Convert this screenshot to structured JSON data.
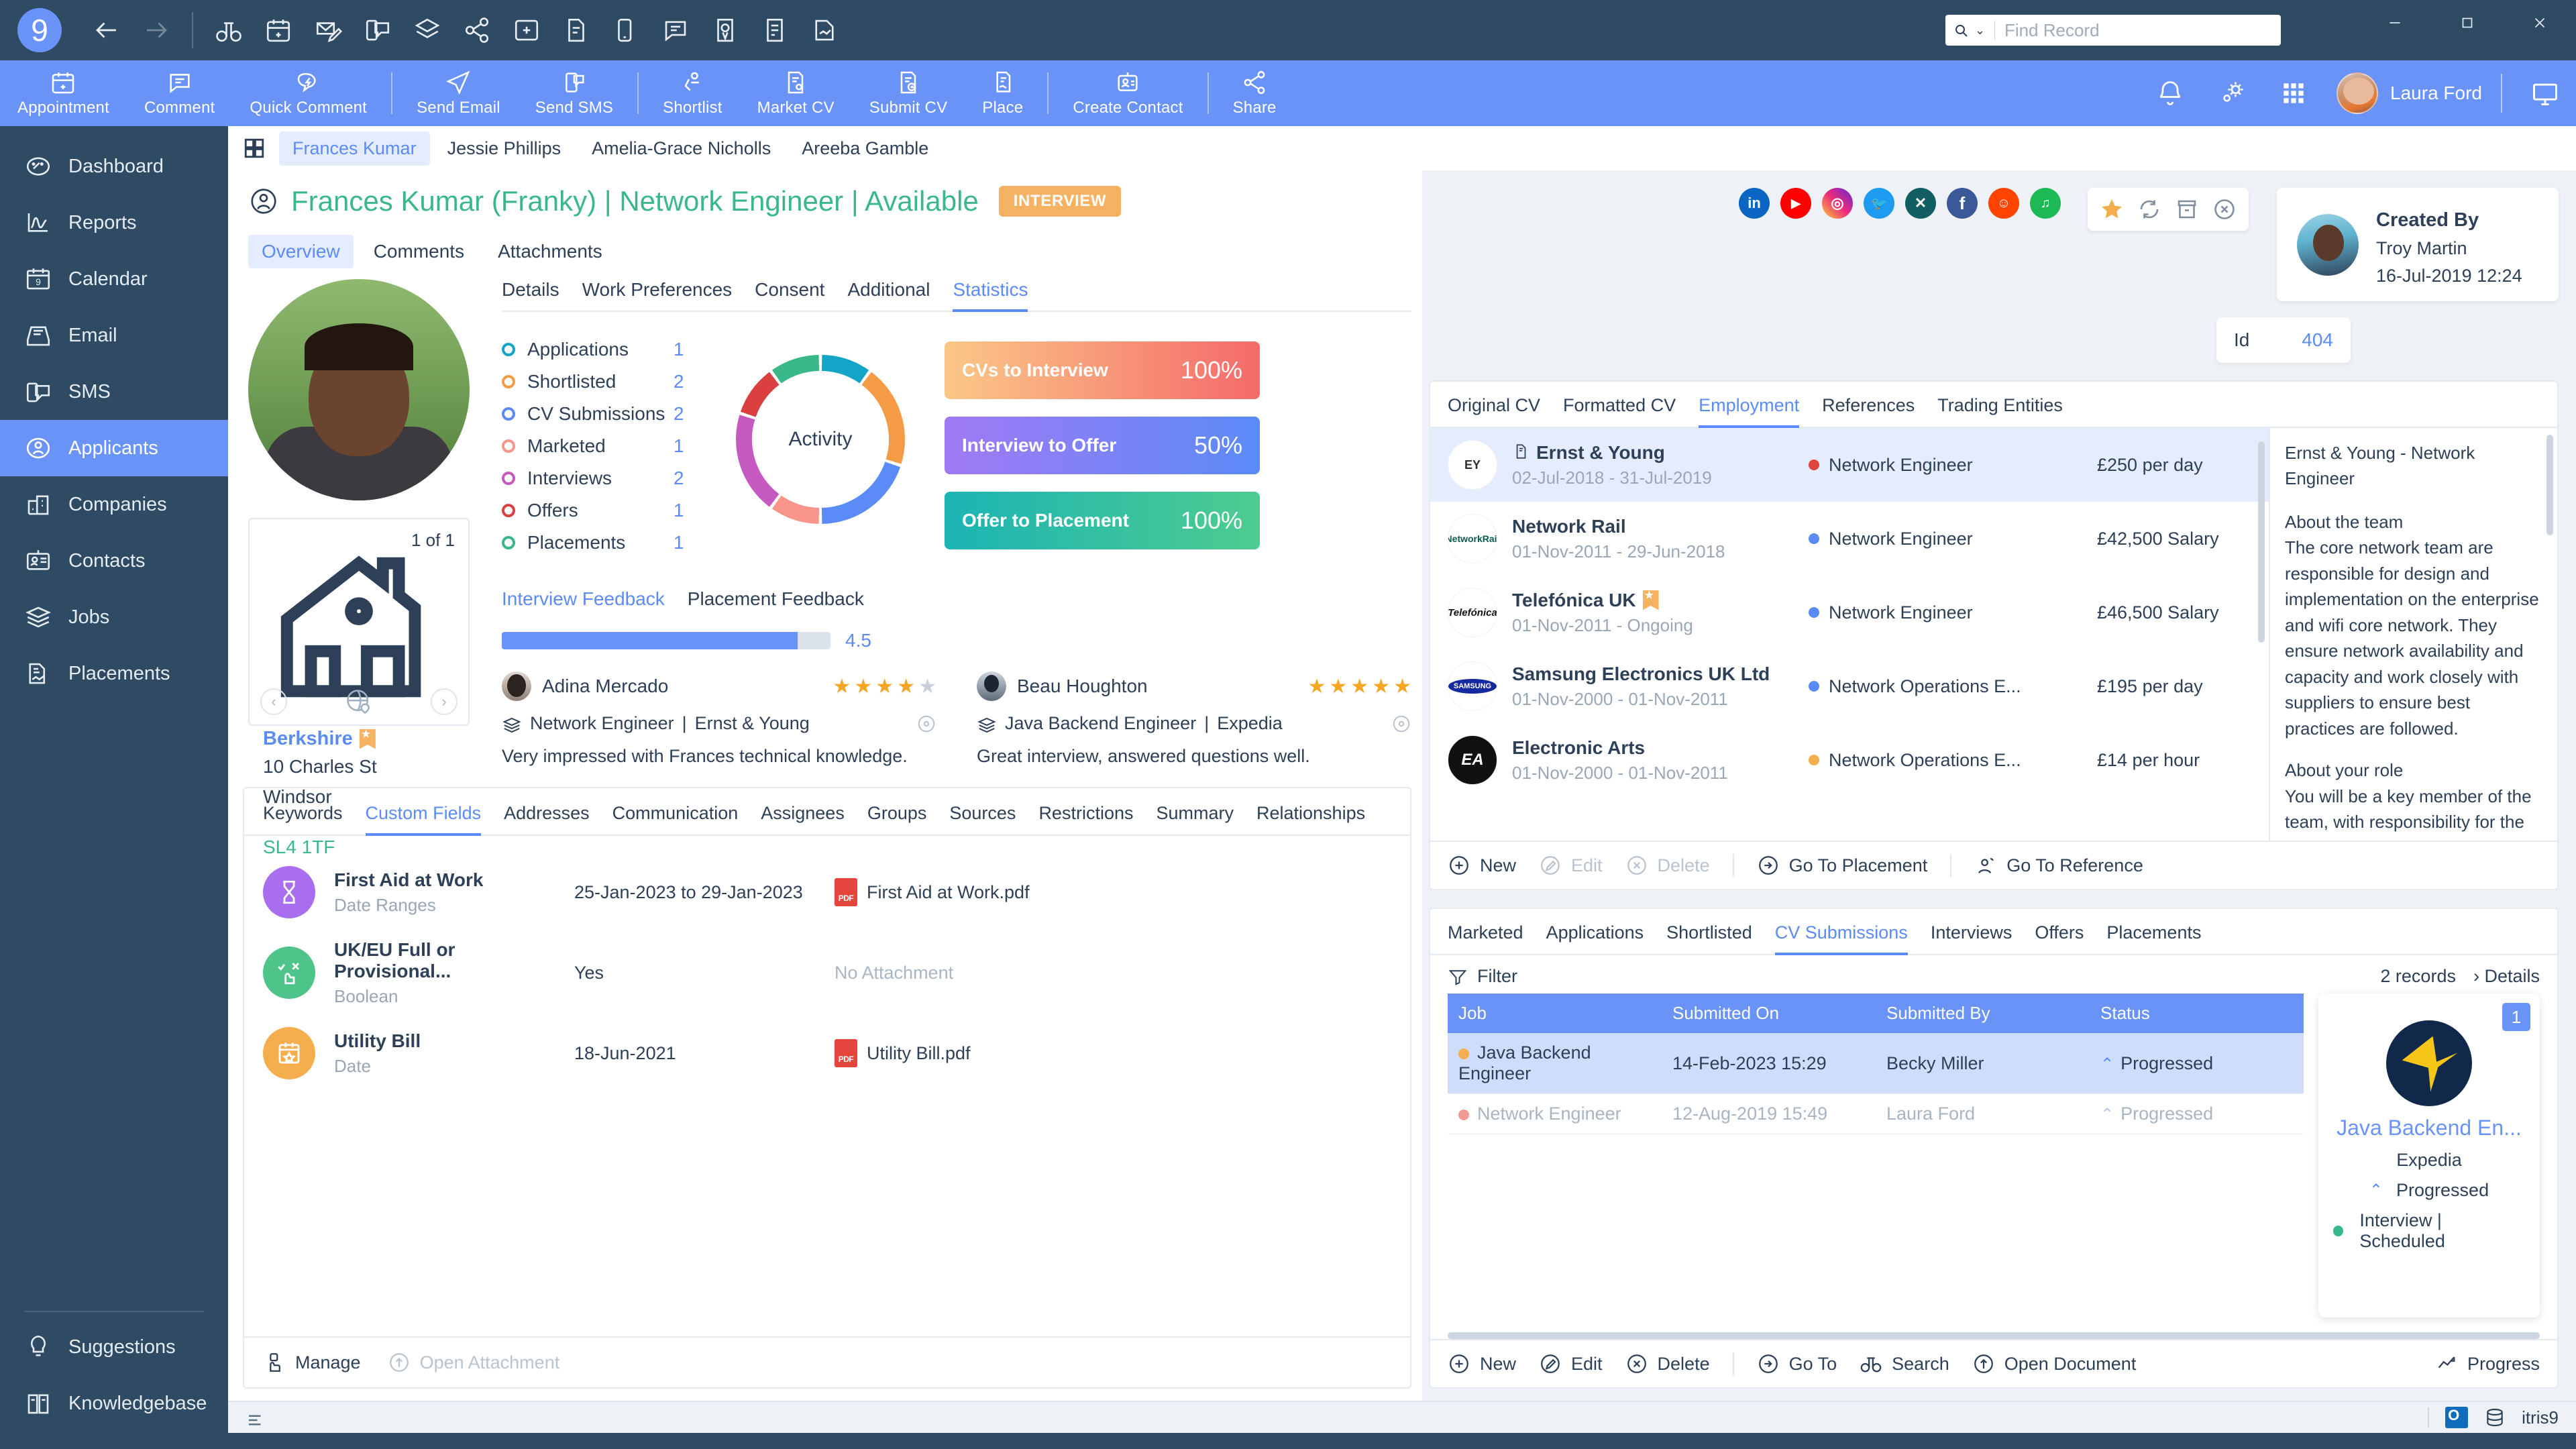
{
  "titlebar": {
    "logo": "9",
    "icons": [
      "back-arrow",
      "forward-arrow",
      "binoculars",
      "calendar-add",
      "email-compose",
      "sms",
      "jobs-stack",
      "share-nodes",
      "add-record",
      "document-submit",
      "phone-call",
      "comment",
      "market-cv",
      "report",
      "placement"
    ],
    "search": {
      "placeholder": "Find Record",
      "value": ""
    },
    "window_controls": [
      "minimize",
      "restore",
      "close"
    ]
  },
  "ribbon": {
    "items": [
      {
        "label": "Appointment",
        "icon": "calendar-add-icon"
      },
      {
        "label": "Comment",
        "icon": "comment-icon"
      },
      {
        "label": "Quick Comment",
        "icon": "quick-comment-icon"
      },
      {
        "label": "Send Email",
        "icon": "send-email-icon"
      },
      {
        "label": "Send SMS",
        "icon": "send-sms-icon"
      },
      {
        "label": "Shortlist",
        "icon": "shortlist-icon"
      },
      {
        "label": "Market CV",
        "icon": "market-cv-icon"
      },
      {
        "label": "Submit CV",
        "icon": "submit-cv-icon"
      },
      {
        "label": "Place",
        "icon": "place-icon"
      },
      {
        "label": "Create Contact",
        "icon": "create-contact-icon"
      },
      {
        "label": "Share",
        "icon": "share-icon"
      }
    ],
    "user": "Laura Ford",
    "right_icons": [
      "notifications-icon",
      "settings-icon",
      "apps-grid-icon",
      "screen-icon"
    ]
  },
  "sidebar": {
    "items": [
      {
        "label": "Dashboard",
        "icon": "dashboard-icon",
        "active": false
      },
      {
        "label": "Reports",
        "icon": "reports-icon",
        "active": false
      },
      {
        "label": "Calendar",
        "icon": "calendar-icon",
        "active": false
      },
      {
        "label": "Email",
        "icon": "email-icon",
        "active": false
      },
      {
        "label": "SMS",
        "icon": "sms-icon",
        "active": false
      },
      {
        "label": "Applicants",
        "icon": "applicants-icon",
        "active": true
      },
      {
        "label": "Companies",
        "icon": "companies-icon",
        "active": false
      },
      {
        "label": "Contacts",
        "icon": "contacts-icon",
        "active": false
      },
      {
        "label": "Jobs",
        "icon": "jobs-icon",
        "active": false
      },
      {
        "label": "Placements",
        "icon": "placements-icon",
        "active": false
      }
    ],
    "bottom": [
      {
        "label": "Suggestions",
        "icon": "suggestions-icon"
      },
      {
        "label": "Knowledgebase",
        "icon": "knowledgebase-icon"
      }
    ]
  },
  "record_tabs": [
    {
      "label": "Frances Kumar",
      "active": true
    },
    {
      "label": "Jessie Phillips",
      "active": false
    },
    {
      "label": "Amelia-Grace Nicholls",
      "active": false
    },
    {
      "label": "Areeba Gamble",
      "active": false
    }
  ],
  "record": {
    "title": "Frances Kumar (Franky) | Network Engineer | Available",
    "status_badge": "INTERVIEW",
    "sub_tabs": [
      {
        "label": "Overview",
        "active": true
      },
      {
        "label": "Comments",
        "active": false
      },
      {
        "label": "Attachments",
        "active": false
      }
    ]
  },
  "address": {
    "count": "1 of 1",
    "city": "Berkshire",
    "street": "10 Charles St",
    "town": "Windsor",
    "postcode": "SL4 1TF"
  },
  "detail_tabs": [
    {
      "label": "Details",
      "active": false
    },
    {
      "label": "Work Preferences",
      "active": false
    },
    {
      "label": "Consent",
      "active": false
    },
    {
      "label": "Additional",
      "active": false
    },
    {
      "label": "Statistics",
      "active": true
    }
  ],
  "chart_data": {
    "type": "pie",
    "title": "Activity",
    "center_label": "Activity",
    "categories": [
      "Applications",
      "Shortlisted",
      "CV Submissions",
      "Marketed",
      "Interviews",
      "Offers",
      "Placements"
    ],
    "values": [
      1,
      2,
      2,
      1,
      2,
      1,
      1
    ],
    "colors": [
      "#13a4c8",
      "#f59a45",
      "#5b8bf7",
      "#f9958a",
      "#c559bf",
      "#d9403f",
      "#3bb88a"
    ],
    "legend_position": "left",
    "grid": false
  },
  "kpis": [
    {
      "label": "CVs to Interview",
      "value": "100%",
      "from": "#fbc888",
      "to": "#f56a6a"
    },
    {
      "label": "Interview to Offer",
      "value": "50%",
      "from": "#a07af5",
      "to": "#5b8bf7"
    },
    {
      "label": "Offer to Placement",
      "value": "100%",
      "from": "#1bb4b4",
      "to": "#4ecc8f"
    }
  ],
  "feedback": {
    "tabs": [
      {
        "label": "Interview Feedback",
        "active": true
      },
      {
        "label": "Placement Feedback",
        "active": false
      }
    ],
    "rating_value": "4.5",
    "rating_percent": 90,
    "cards": [
      {
        "name": "Adina Mercado",
        "stars": 4,
        "job": "Network Engineer",
        "company": "Ernst & Young",
        "text": "Very impressed with Frances technical knowledge."
      },
      {
        "name": "Beau Houghton",
        "stars": 5,
        "job": "Java Backend Engineer",
        "company": "Expedia",
        "text": "Great interview, answered questions well."
      }
    ]
  },
  "custom_fields_panel": {
    "tabs": [
      {
        "label": "Keywords",
        "active": false
      },
      {
        "label": "Custom Fields",
        "active": true
      },
      {
        "label": "Addresses",
        "active": false
      },
      {
        "label": "Communication",
        "active": false
      },
      {
        "label": "Assignees",
        "active": false
      },
      {
        "label": "Groups",
        "active": false
      },
      {
        "label": "Sources",
        "active": false
      },
      {
        "label": "Restrictions",
        "active": false
      },
      {
        "label": "Summary",
        "active": false
      },
      {
        "label": "Relationships",
        "active": false
      }
    ],
    "rows": [
      {
        "title": "First Aid at Work",
        "type": "Date Ranges",
        "value": "25-Jan-2023 to 29-Jan-2023",
        "attachment": "First Aid at Work.pdf",
        "has_attachment": true,
        "icon_color": "#a96ef0",
        "icon": "hourglass-icon"
      },
      {
        "title": "UK/EU Full or Provisional...",
        "type": "Boolean",
        "value": "Yes",
        "attachment": "No Attachment",
        "has_attachment": false,
        "icon_color": "#4ec48a",
        "icon": "tick-cross-icon"
      },
      {
        "title": "Utility Bill",
        "type": "Date",
        "value": "18-Jun-2021",
        "attachment": "Utility Bill.pdf",
        "has_attachment": true,
        "icon_color": "#f5ae4e",
        "icon": "calendar-star-icon"
      }
    ],
    "footer": [
      {
        "label": "Manage",
        "disabled": false,
        "icon": "hand-click-icon"
      },
      {
        "label": "Open Attachment",
        "disabled": true,
        "icon": "open-up-icon"
      }
    ]
  },
  "social_icons": [
    {
      "name": "linkedin-icon",
      "glyph": "in",
      "color": "#0a66c2"
    },
    {
      "name": "youtube-icon",
      "glyph": "▶",
      "color": "#ff0000"
    },
    {
      "name": "instagram-icon",
      "glyph": "◎",
      "color": "#d62976"
    },
    {
      "name": "twitter-icon",
      "glyph": "➤",
      "color": "#1d9bf0"
    },
    {
      "name": "xing-icon",
      "glyph": "X",
      "color": "#115f62"
    },
    {
      "name": "facebook-icon",
      "glyph": "f",
      "color": "#3b5998"
    },
    {
      "name": "reddit-icon",
      "glyph": "●",
      "color": "#ff4500"
    },
    {
      "name": "spotify-icon",
      "glyph": "♫",
      "color": "#1db954"
    }
  ],
  "action_icons": [
    "favourite-star-icon",
    "refresh-icon",
    "archive-icon",
    "close-icon"
  ],
  "id_card": {
    "label": "Id",
    "value": "404"
  },
  "created_by": {
    "heading": "Created By",
    "name": "Troy Martin",
    "date": "16-Jul-2019 12:24"
  },
  "employment_panel": {
    "tabs": [
      {
        "label": "Original CV",
        "active": false
      },
      {
        "label": "Formatted CV",
        "active": false
      },
      {
        "label": "Employment",
        "active": true
      },
      {
        "label": "References",
        "active": false
      },
      {
        "label": "Trading Entities",
        "active": false
      }
    ],
    "rows": [
      {
        "company": "Ernst & Young",
        "dates": "02-Jul-2018 - 31-Jul-2019",
        "role": "Network Engineer",
        "dot": "#e0453f",
        "pay": "£250 per day",
        "selected": true,
        "logo": "EY",
        "logo_bg": "#ffffff",
        "logo_color": "#2e2e2e",
        "flag": false
      },
      {
        "company": "Network Rail",
        "dates": "01-Nov-2011 - 29-Jun-2018",
        "role": "Network Engineer",
        "dot": "#5b8bf7",
        "pay": "£42,500 Salary",
        "selected": false,
        "logo": "NetworkRail",
        "logo_bg": "#ffffff",
        "logo_color": "#0a5c4f",
        "flag": false
      },
      {
        "company": "Telefónica UK",
        "dates": "01-Nov-2011 - Ongoing",
        "role": "Network Engineer",
        "dot": "#5b8bf7",
        "pay": "£46,500 Salary",
        "selected": false,
        "logo": "Telefónica",
        "logo_bg": "#ffffff",
        "logo_color": "#1a1a1a",
        "flag": true
      },
      {
        "company": "Samsung Electronics UK Ltd",
        "dates": "01-Nov-2000 - 01-Nov-2011",
        "role": "Network Operations E...",
        "dot": "#5b8bf7",
        "pay": "£195 per day",
        "selected": false,
        "logo": "SAMSUNG",
        "logo_bg": "#1428a0",
        "logo_color": "#ffffff",
        "flag": false
      },
      {
        "company": "Electronic Arts",
        "dates": "01-Nov-2000 - 01-Nov-2011",
        "role": "Network Operations E...",
        "dot": "#f5ae4e",
        "pay": "£14 per hour",
        "selected": false,
        "logo": "EA",
        "logo_bg": "#111111",
        "logo_color": "#ffffff",
        "flag": false
      }
    ],
    "description": {
      "title": "Ernst & Young - Network Engineer",
      "section1_heading": "About the team",
      "section1_text": "The core network team are responsible for design and implementation on the enterprise and wifi core network. They ensure network availability and capacity and work closely with suppliers to ensure best practices are followed.",
      "section2_heading": "About your role",
      "section2_text": "You will be a key member of the team, with responsibility for the ensuring the core network is designed and implemented to best practise and to"
    },
    "footer": [
      {
        "label": "New",
        "disabled": false,
        "icon": "plus-circle-icon"
      },
      {
        "label": "Edit",
        "disabled": true,
        "icon": "pencil-circle-icon"
      },
      {
        "label": "Delete",
        "disabled": true,
        "icon": "x-circle-icon"
      },
      {
        "label": "Go To Placement",
        "disabled": false,
        "icon": "go-to-icon"
      },
      {
        "label": "Go To Reference",
        "disabled": false,
        "icon": "reference-icon"
      }
    ]
  },
  "submissions_panel": {
    "tabs": [
      {
        "label": "Marketed",
        "active": false
      },
      {
        "label": "Applications",
        "active": false
      },
      {
        "label": "Shortlisted",
        "active": false
      },
      {
        "label": "CV Submissions",
        "active": true
      },
      {
        "label": "Interviews",
        "active": false
      },
      {
        "label": "Offers",
        "active": false
      },
      {
        "label": "Placements",
        "active": false
      }
    ],
    "filter_label": "Filter",
    "record_count": "2 records",
    "details_label": "Details",
    "columns": [
      "Job",
      "Submitted On",
      "Submitted By",
      "Status"
    ],
    "rows": [
      {
        "job": "Java Backend Engineer",
        "dot": "#f5ae4e",
        "submitted_on": "14-Feb-2023 15:29",
        "submitted_by": "Becky Miller",
        "status": "Progressed",
        "selected": true
      },
      {
        "job": "Network Engineer",
        "dot": "#f09a93",
        "submitted_on": "12-Aug-2019 15:49",
        "submitted_by": "Laura Ford",
        "status": "Progressed",
        "selected": false
      }
    ],
    "job_card": {
      "badge": "1",
      "title": "Java Backend En...",
      "company": "Expedia",
      "status": "Progressed",
      "stage": "Interview | Scheduled"
    },
    "footer": [
      {
        "label": "New",
        "disabled": false,
        "icon": "plus-circle-icon"
      },
      {
        "label": "Edit",
        "disabled": false,
        "icon": "pencil-circle-icon"
      },
      {
        "label": "Delete",
        "disabled": false,
        "icon": "x-circle-icon"
      },
      {
        "label": "Go To",
        "disabled": false,
        "icon": "go-to-icon"
      },
      {
        "label": "Search",
        "disabled": false,
        "icon": "binoculars-icon"
      },
      {
        "label": "Open Document",
        "disabled": false,
        "icon": "open-up-icon"
      },
      {
        "label": "Progress",
        "disabled": false,
        "icon": "progress-icon"
      }
    ]
  },
  "statusbar": {
    "app_name": "itris9",
    "outlook": "outlook-icon"
  }
}
